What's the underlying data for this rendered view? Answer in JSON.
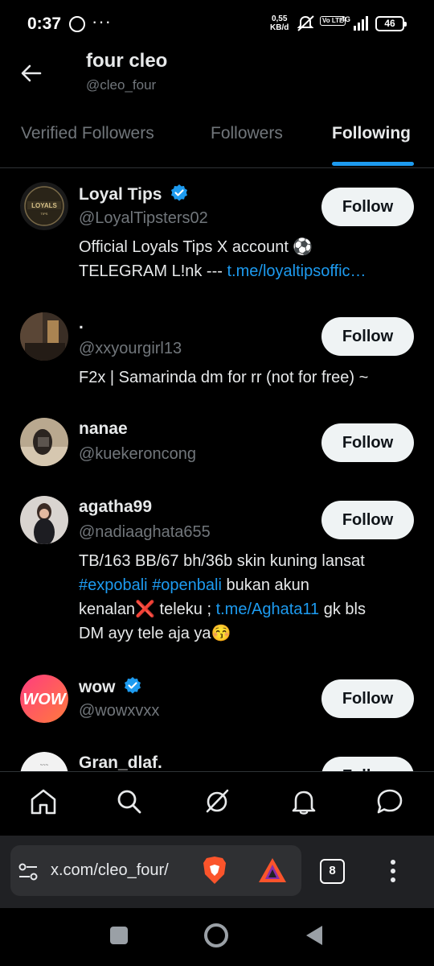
{
  "status_bar": {
    "time": "0:37",
    "net_speed": "0,55",
    "net_unit": "KB/d",
    "volte": "Vo LTE",
    "network": "4G",
    "battery": "46"
  },
  "header": {
    "name": "four cleo",
    "handle": "@cleo_four"
  },
  "tabs": [
    {
      "label": "Verified Followers"
    },
    {
      "label": "Followers"
    },
    {
      "label": "Following",
      "active": true
    }
  ],
  "follow_label": "Follow",
  "users": [
    {
      "name": "Loyal Tips",
      "verified": true,
      "handle": "@LoyalTipsters02",
      "bio_line1": "Official Loyals Tips X account ⚽",
      "bio_line2_text": "TELEGRAM L!nk --- ",
      "bio_line2_link": "t.me/loyaltipsoffic…"
    },
    {
      "name": ".",
      "verified": false,
      "handle": "@xxyourgirl13",
      "bio_line1": "F2x | Samarinda dm for rr (not for free) ~"
    },
    {
      "name": "nanae",
      "verified": false,
      "handle": "@kuekeroncong"
    },
    {
      "name": "agatha99",
      "verified": false,
      "handle": "@nadiaaghata655",
      "bio_line1": "TB/163 BB/67 bh/36b skin kuning lansat",
      "bio_line2_link1": "#expobali",
      "bio_line2_link2": "#openbali",
      "bio_line2_text": " bukan akun",
      "bio_line3_text1": "kenalan❌ teleku ; ",
      "bio_line3_link": "t.me/Aghata11",
      "bio_line3_text2": " gk bls",
      "bio_line4": "DM ayy tele aja ya😚"
    },
    {
      "name": "wow",
      "verified": true,
      "handle": "@wowxvxx"
    },
    {
      "name": "Gran_dlaf.",
      "verified": false,
      "handle": ""
    }
  ],
  "browser": {
    "url": "x.com/cleo_four/",
    "tab_count": "8"
  },
  "colors": {
    "accent": "#1d9bf0",
    "background": "#000000",
    "muted_text": "#71767b"
  }
}
